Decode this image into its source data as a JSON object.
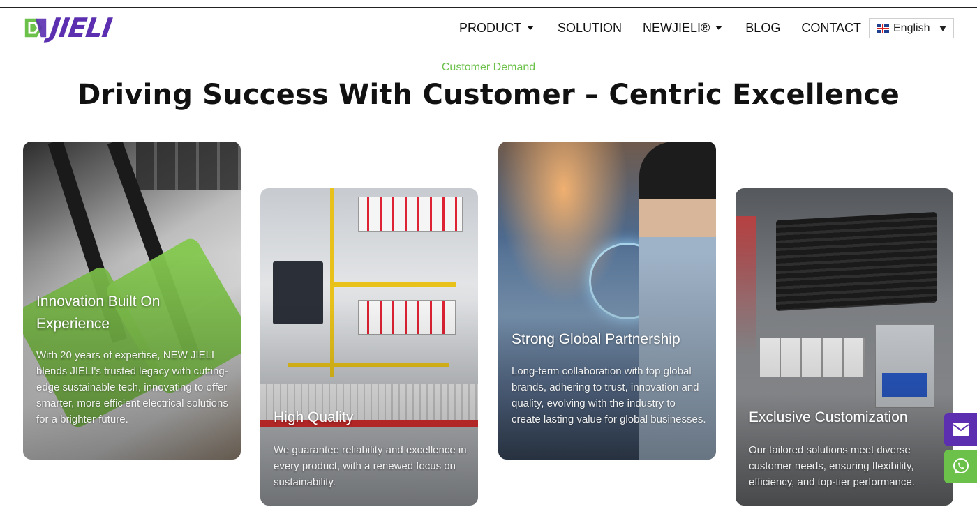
{
  "brand": {
    "logo_text": "JIELI",
    "logo_icon": "jieli-logo-icon",
    "logo_color": "#5b2fb0",
    "accent_color": "#6cc14a"
  },
  "nav": {
    "items": [
      {
        "label": "PRODUCT",
        "has_dropdown": true
      },
      {
        "label": "SOLUTION",
        "has_dropdown": false
      },
      {
        "label": "NEWJIELI®",
        "has_dropdown": true
      },
      {
        "label": "BLOG",
        "has_dropdown": false
      },
      {
        "label": "CONTACT",
        "has_dropdown": false
      }
    ],
    "language": {
      "label": "English",
      "flag_icon": "uk-flag-icon"
    }
  },
  "section": {
    "eyebrow": "Customer Demand",
    "title": "Driving Success With Customer – Centric Excellence"
  },
  "cards": [
    {
      "title_line1": "Innovation Built On",
      "title_line2": "Experience",
      "body": "With 20 years of expertise, NEW JIELI blends JIELI's trusted legacy with cutting-edge sustainable tech, innovating to offer smarter, more efficient electrical solutions for a brighter future."
    },
    {
      "title": "High Quality",
      "body": "We guarantee reliability and excellence in every product, with a renewed focus on sustainability."
    },
    {
      "title": "Strong Global Partnership",
      "body": "Long-term collaboration with top global brands, adhering to trust, innovation and quality, evolving with the industry to create lasting value for global businesses."
    },
    {
      "title": "Exclusive Customization",
      "body": "Our tailored solutions meet diverse customer needs, ensuring flexibility, efficiency, and top-tier performance."
    }
  ],
  "floating": {
    "mail_icon": "mail-icon",
    "whatsapp_icon": "whatsapp-icon",
    "mail_color": "#5b2fb0",
    "whatsapp_color": "#6cc14a"
  }
}
